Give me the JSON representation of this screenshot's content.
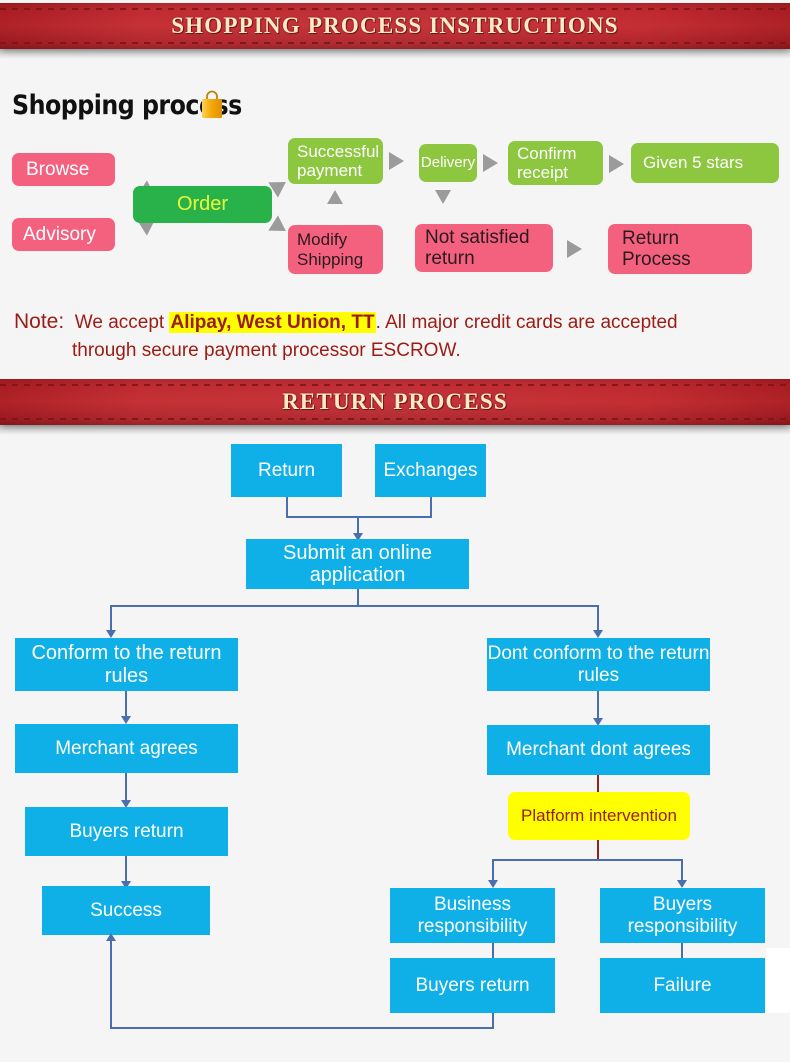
{
  "banners": {
    "shopping": "SHOPPING PROCESS INSTRUCTIONS",
    "return": "RETURN PROCESS"
  },
  "shopping_section": {
    "title": "Shopping process",
    "bag_icon": "shopping-bag-icon",
    "nodes": {
      "browse": "Browse",
      "advisory": "Advisory",
      "order": "Order",
      "successful_payment": "Successful payment",
      "modify_shipping": "Modify Shipping",
      "delivery": "Delivery",
      "confirm_receipt": "Confirm receipt",
      "given_5_stars": "Given 5 stars",
      "not_satisfied_return": "Not satisfied return",
      "return_process": "Return Process"
    },
    "note": {
      "label": "Note:",
      "line1_pre": "We accept ",
      "highlight": "Alipay, West Union, TT",
      "line1_post": ". All major credit cards are accepted",
      "line2": "through secure payment processor ESCROW."
    }
  },
  "return_section": {
    "nodes": {
      "return": "Return",
      "exchanges": "Exchanges",
      "submit": "Submit an online application",
      "conform": "Conform to the return rules",
      "dont_conform": "Dont conform to the return rules",
      "merchant_agrees": "Merchant agrees",
      "merchant_dont_agrees": "Merchant dont agrees",
      "platform_intervention": "Platform intervention",
      "buyers_return_left": "Buyers return",
      "success": "Success",
      "business_responsibility": "Business responsibility",
      "buyers_responsibility": "Buyers responsibility",
      "buyers_return_bottom": "Buyers return",
      "failure": "Failure"
    }
  },
  "colors": {
    "banner_red": "#bb2026",
    "banner_text": "#fdebc8",
    "pink": "#f4617f",
    "green_dark": "#2ab24a",
    "green_light": "#8dc63f",
    "order_text": "#e9f93c",
    "cyan": "#0fb0e8",
    "yellow": "#ffff00",
    "note_red": "#9c1b14",
    "connector_blue": "#4a6fae",
    "arrow_gray": "#9b9b9b"
  }
}
